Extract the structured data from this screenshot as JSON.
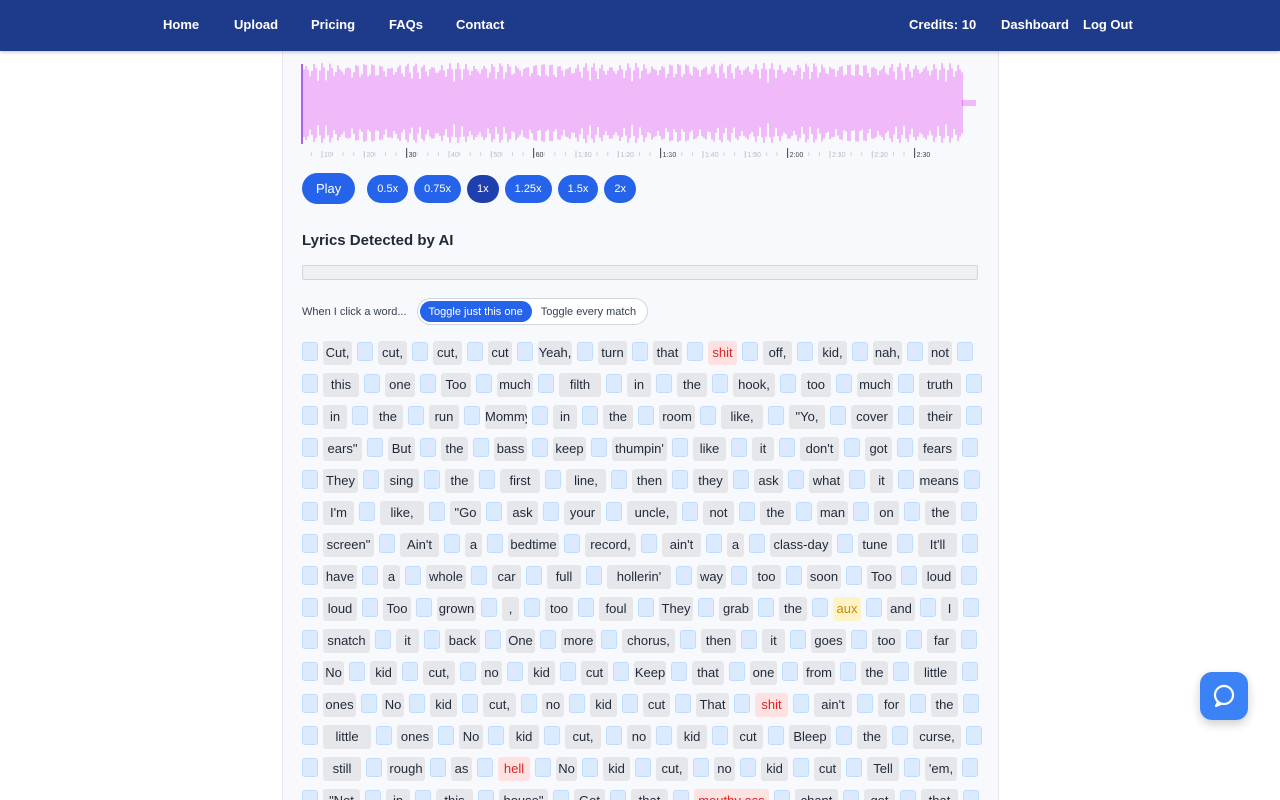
{
  "nav": {
    "left": [
      "Home",
      "Upload",
      "Pricing",
      "FAQs",
      "Contact"
    ],
    "credits": "Credits: 10",
    "dashboard": "Dashboard",
    "logout": "Log Out"
  },
  "waveform": {
    "tick_labels": [
      "10",
      "20",
      "30",
      "40",
      "50",
      "60",
      "1:10",
      "1:20",
      "1:30",
      "1:40",
      "1:50",
      "2:00",
      "2:10",
      "2:20",
      "2:30"
    ],
    "color": "#e879f9"
  },
  "player": {
    "play_label": "Play",
    "speeds": [
      "0.5x",
      "0.75x",
      "1x",
      "1.25x",
      "1.5x",
      "2x"
    ],
    "active_speed": "1x"
  },
  "lyrics": {
    "title": "Lyrics Detected by AI",
    "click_label": "When I click a word...",
    "toggle_options": [
      "Toggle just this one",
      "Toggle every match"
    ],
    "active_toggle": "Toggle just this one",
    "lines": [
      [
        {
          "t": "Cut,"
        },
        {
          "t": "cut,"
        },
        {
          "t": "cut,"
        },
        {
          "t": "cut"
        },
        {
          "t": "Yeah,"
        },
        {
          "t": "turn"
        },
        {
          "t": "that"
        },
        {
          "t": "shit",
          "s": "bleep"
        },
        {
          "t": "off,"
        },
        {
          "t": "kid,"
        },
        {
          "t": "nah,"
        },
        {
          "t": "not"
        }
      ],
      [
        {
          "t": "this"
        },
        {
          "t": "one"
        },
        {
          "t": "Too"
        },
        {
          "t": "much"
        },
        {
          "t": "filth"
        },
        {
          "t": "in"
        },
        {
          "t": "the"
        },
        {
          "t": "hook,"
        },
        {
          "t": "too"
        },
        {
          "t": "much"
        },
        {
          "t": "truth"
        }
      ],
      [
        {
          "t": "in"
        },
        {
          "t": "the"
        },
        {
          "t": "run"
        },
        {
          "t": "Mommy"
        },
        {
          "t": "in"
        },
        {
          "t": "the"
        },
        {
          "t": "room"
        },
        {
          "t": "like,"
        },
        {
          "t": "\"Yo,"
        },
        {
          "t": "cover"
        },
        {
          "t": "their"
        }
      ],
      [
        {
          "t": "ears\""
        },
        {
          "t": "But"
        },
        {
          "t": "the"
        },
        {
          "t": "bass"
        },
        {
          "t": "keep"
        },
        {
          "t": "thumpin'"
        },
        {
          "t": "like"
        },
        {
          "t": "it"
        },
        {
          "t": "don't"
        },
        {
          "t": "got"
        },
        {
          "t": "fears"
        }
      ],
      [
        {
          "t": "They"
        },
        {
          "t": "sing"
        },
        {
          "t": "the"
        },
        {
          "t": "first"
        },
        {
          "t": "line,"
        },
        {
          "t": "then"
        },
        {
          "t": "they"
        },
        {
          "t": "ask"
        },
        {
          "t": "what"
        },
        {
          "t": "it"
        },
        {
          "t": "means"
        }
      ],
      [
        {
          "t": "I'm"
        },
        {
          "t": "like,"
        },
        {
          "t": "\"Go"
        },
        {
          "t": "ask"
        },
        {
          "t": "your"
        },
        {
          "t": "uncle,"
        },
        {
          "t": "not"
        },
        {
          "t": "the"
        },
        {
          "t": "man"
        },
        {
          "t": "on"
        },
        {
          "t": "the"
        }
      ],
      [
        {
          "t": "screen\""
        },
        {
          "t": "Ain't"
        },
        {
          "t": "a"
        },
        {
          "t": "bedtime"
        },
        {
          "t": "record,"
        },
        {
          "t": "ain't"
        },
        {
          "t": "a"
        },
        {
          "t": "class-day"
        },
        {
          "t": "tune"
        },
        {
          "t": "It'll"
        }
      ],
      [
        {
          "t": "have"
        },
        {
          "t": "a"
        },
        {
          "t": "whole"
        },
        {
          "t": "car"
        },
        {
          "t": "full"
        },
        {
          "t": "hollerin'"
        },
        {
          "t": "way"
        },
        {
          "t": "too"
        },
        {
          "t": "soon"
        },
        {
          "t": "Too"
        },
        {
          "t": "loud"
        }
      ],
      [
        {
          "t": "loud"
        },
        {
          "t": "Too"
        },
        {
          "t": "grown"
        },
        {
          "t": ","
        },
        {
          "t": "too"
        },
        {
          "t": "foul"
        },
        {
          "t": "They"
        },
        {
          "t": "grab"
        },
        {
          "t": "the"
        },
        {
          "t": "aux",
          "s": "warn"
        },
        {
          "t": "and"
        },
        {
          "t": "I"
        }
      ],
      [
        {
          "t": "snatch"
        },
        {
          "t": "it"
        },
        {
          "t": "back"
        },
        {
          "t": "One"
        },
        {
          "t": "more"
        },
        {
          "t": "chorus,"
        },
        {
          "t": "then"
        },
        {
          "t": "it"
        },
        {
          "t": "goes"
        },
        {
          "t": "too"
        },
        {
          "t": "far"
        }
      ],
      [
        {
          "t": "No"
        },
        {
          "t": "kid"
        },
        {
          "t": "cut,"
        },
        {
          "t": "no"
        },
        {
          "t": "kid"
        },
        {
          "t": "cut"
        },
        {
          "t": "Keep"
        },
        {
          "t": "that"
        },
        {
          "t": "one"
        },
        {
          "t": "from"
        },
        {
          "t": "the"
        },
        {
          "t": "little"
        }
      ],
      [
        {
          "t": "ones"
        },
        {
          "t": "No"
        },
        {
          "t": "kid"
        },
        {
          "t": "cut,"
        },
        {
          "t": "no"
        },
        {
          "t": "kid"
        },
        {
          "t": "cut"
        },
        {
          "t": "That"
        },
        {
          "t": "shit",
          "s": "bleep"
        },
        {
          "t": "ain't"
        },
        {
          "t": "for"
        },
        {
          "t": "the"
        }
      ],
      [
        {
          "t": "little"
        },
        {
          "t": "ones"
        },
        {
          "t": "No"
        },
        {
          "t": "kid"
        },
        {
          "t": "cut,"
        },
        {
          "t": "no"
        },
        {
          "t": "kid"
        },
        {
          "t": "cut"
        },
        {
          "t": "Bleep"
        },
        {
          "t": "the"
        },
        {
          "t": "curse,"
        }
      ],
      [
        {
          "t": "still"
        },
        {
          "t": "rough"
        },
        {
          "t": "as"
        },
        {
          "t": "hell",
          "s": "bleep"
        },
        {
          "t": "No"
        },
        {
          "t": "kid"
        },
        {
          "t": "cut,"
        },
        {
          "t": "no"
        },
        {
          "t": "kid"
        },
        {
          "t": "cut"
        },
        {
          "t": "Tell"
        },
        {
          "t": "'em,"
        }
      ],
      [
        {
          "t": "\"Not"
        },
        {
          "t": "in"
        },
        {
          "t": "this"
        },
        {
          "t": "house\""
        },
        {
          "t": "Got"
        },
        {
          "t": "that"
        },
        {
          "t": "mouthy ass",
          "s": "bleep"
        },
        {
          "t": "chant"
        },
        {
          "t": "got"
        },
        {
          "t": "that"
        }
      ]
    ]
  }
}
